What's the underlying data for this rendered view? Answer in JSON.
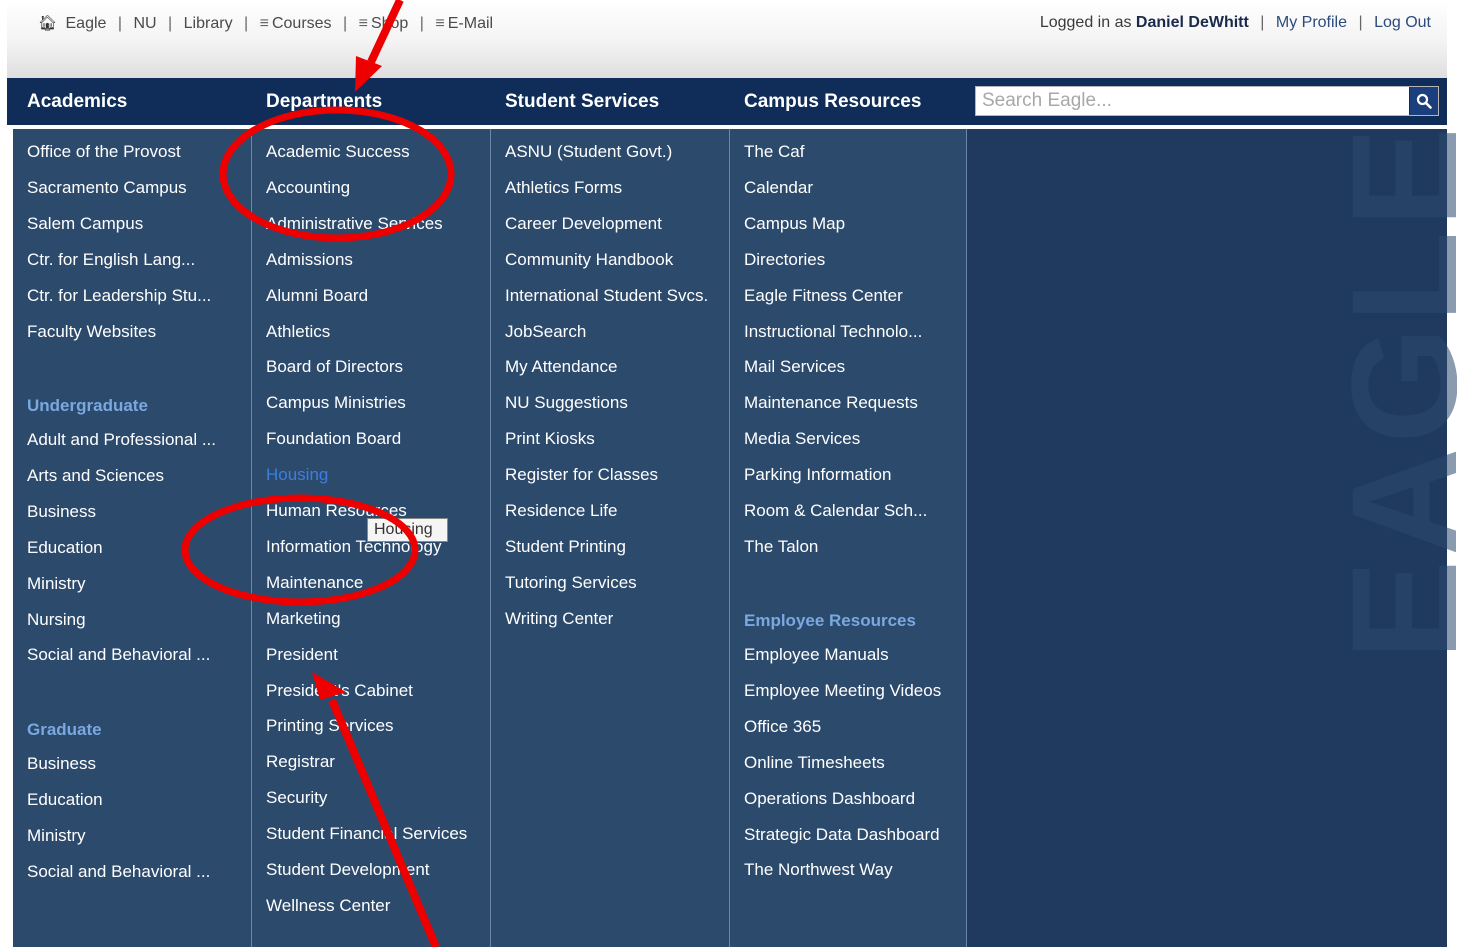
{
  "topbar": {
    "links": [
      "Eagle",
      "NU",
      "Library",
      "Courses",
      "Shop",
      "E-Mail"
    ],
    "logged_in_prefix": "Logged in as",
    "user_name": "Daniel DeWhitt",
    "my_profile": "My Profile",
    "log_out": "Log Out",
    "separator": "|"
  },
  "navbar": {
    "headers": [
      "Academics",
      "Departments",
      "Student Services",
      "Campus Resources"
    ],
    "search_placeholder": "Search Eagle..."
  },
  "columns": {
    "academics": {
      "items": [
        "Office of the Provost",
        "Sacramento Campus",
        "Salem Campus",
        "Ctr. for English Lang...",
        "Ctr. for Leadership Stu...",
        "Faculty Websites"
      ],
      "undergraduate_title": "Undergraduate",
      "undergraduate": [
        "Adult and Professional ...",
        "Arts and Sciences",
        "Business",
        "Education",
        "Ministry",
        "Nursing",
        "Social and Behavioral ..."
      ],
      "graduate_title": "Graduate",
      "graduate": [
        "Business",
        "Education",
        "Ministry",
        "Social and Behavioral ..."
      ]
    },
    "departments": {
      "items": [
        "Academic Success",
        "Accounting",
        "Administrative Services",
        "Admissions",
        "Alumni Board",
        "Athletics",
        "Board of Directors",
        "Campus Ministries",
        "Foundation Board",
        "Housing",
        "Human Resources",
        "Information Technology",
        "Maintenance",
        "Marketing",
        "President",
        "President's Cabinet",
        "Printing Services",
        "Registrar",
        "Security",
        "Student Financial Services",
        "Student Development",
        "Wellness Center"
      ]
    },
    "student_services": {
      "items": [
        "ASNU (Student Govt.)",
        "Athletics Forms",
        "Career Development",
        "Community Handbook",
        "International Student Svcs.",
        "JobSearch",
        "My Attendance",
        "NU Suggestions",
        "Print Kiosks",
        "Register for Classes",
        "Residence Life",
        "Student Printing",
        "Tutoring Services",
        "Writing Center"
      ]
    },
    "campus_resources": {
      "items": [
        "The Caf",
        "Calendar",
        "Campus Map",
        "Directories",
        "Eagle Fitness Center",
        "Instructional Technolo...",
        "Mail Services",
        "Maintenance Requests",
        "Media Services",
        "Parking Information",
        "Room & Calendar Sch...",
        "The Talon"
      ],
      "employee_title": "Employee Resources",
      "employee": [
        "Employee Manuals",
        "Employee Meeting Videos",
        "Office 365",
        "Online Timesheets",
        "Operations Dashboard",
        "Strategic Data Dashboard",
        "The Northwest Way"
      ]
    }
  },
  "watermark": "EAGLE",
  "tooltip": "Housing",
  "colors": {
    "nav_bg": "#0f2d58",
    "dropdown_bg": "#2c4a6c",
    "section_title": "#7aa8e0",
    "hover_link": "#3d7ee0",
    "annotation_red": "#ee0000"
  },
  "icons": {
    "home": "home-icon",
    "menu": "menu-icon",
    "search": "search-icon"
  }
}
